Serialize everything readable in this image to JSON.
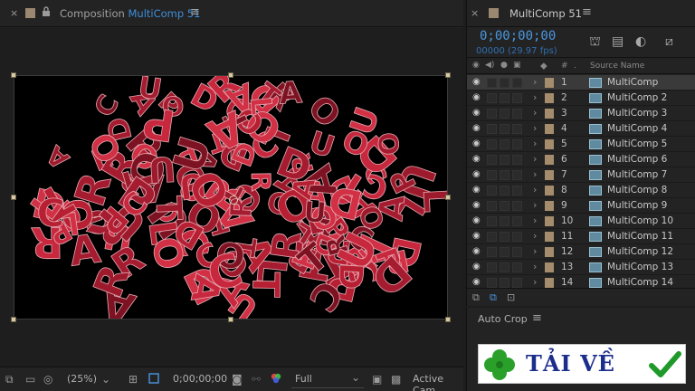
{
  "composition_panel": {
    "close_glyph": "×",
    "lock_glyph": "🔒",
    "title_prefix": "Composition",
    "title_name": "MultiComp 51",
    "menu_glyph": "≡"
  },
  "viewer_bar": {
    "zoom": "(25%)",
    "timecode": "0;00;00;00",
    "resolution": "Full",
    "camera": "Active Cam"
  },
  "timeline_panel": {
    "close_glyph": "×",
    "title": "MultiComp 51",
    "menu_glyph": "≡",
    "timecode": "0;00;00;00",
    "frame_info": "00000 (29.97 fps)",
    "columns": {
      "hash": "#",
      "dot": ".",
      "source_name": "Source Name"
    },
    "layers": [
      {
        "num": "1",
        "name": "MultiComp"
      },
      {
        "num": "2",
        "name": "MultiComp 2"
      },
      {
        "num": "3",
        "name": "MultiComp 3"
      },
      {
        "num": "4",
        "name": "MultiComp 4"
      },
      {
        "num": "5",
        "name": "MultiComp 5"
      },
      {
        "num": "6",
        "name": "MultiComp 6"
      },
      {
        "num": "7",
        "name": "MultiComp 7"
      },
      {
        "num": "8",
        "name": "MultiComp 8"
      },
      {
        "num": "9",
        "name": "MultiComp 9"
      },
      {
        "num": "10",
        "name": "MultiComp 10"
      },
      {
        "num": "11",
        "name": "MultiComp 11"
      },
      {
        "num": "12",
        "name": "MultiComp 12"
      },
      {
        "num": "13",
        "name": "MultiComp 13"
      },
      {
        "num": "14",
        "name": "MultiComp 14"
      }
    ]
  },
  "autocrop_panel": {
    "title": "Auto Crop",
    "menu_glyph": "≡",
    "banner_text": "TẢI VỀ"
  },
  "colors": {
    "accent_blue": "#3e8ed9",
    "label_tan": "#a48c6c",
    "letter_red": "#b71f33"
  }
}
